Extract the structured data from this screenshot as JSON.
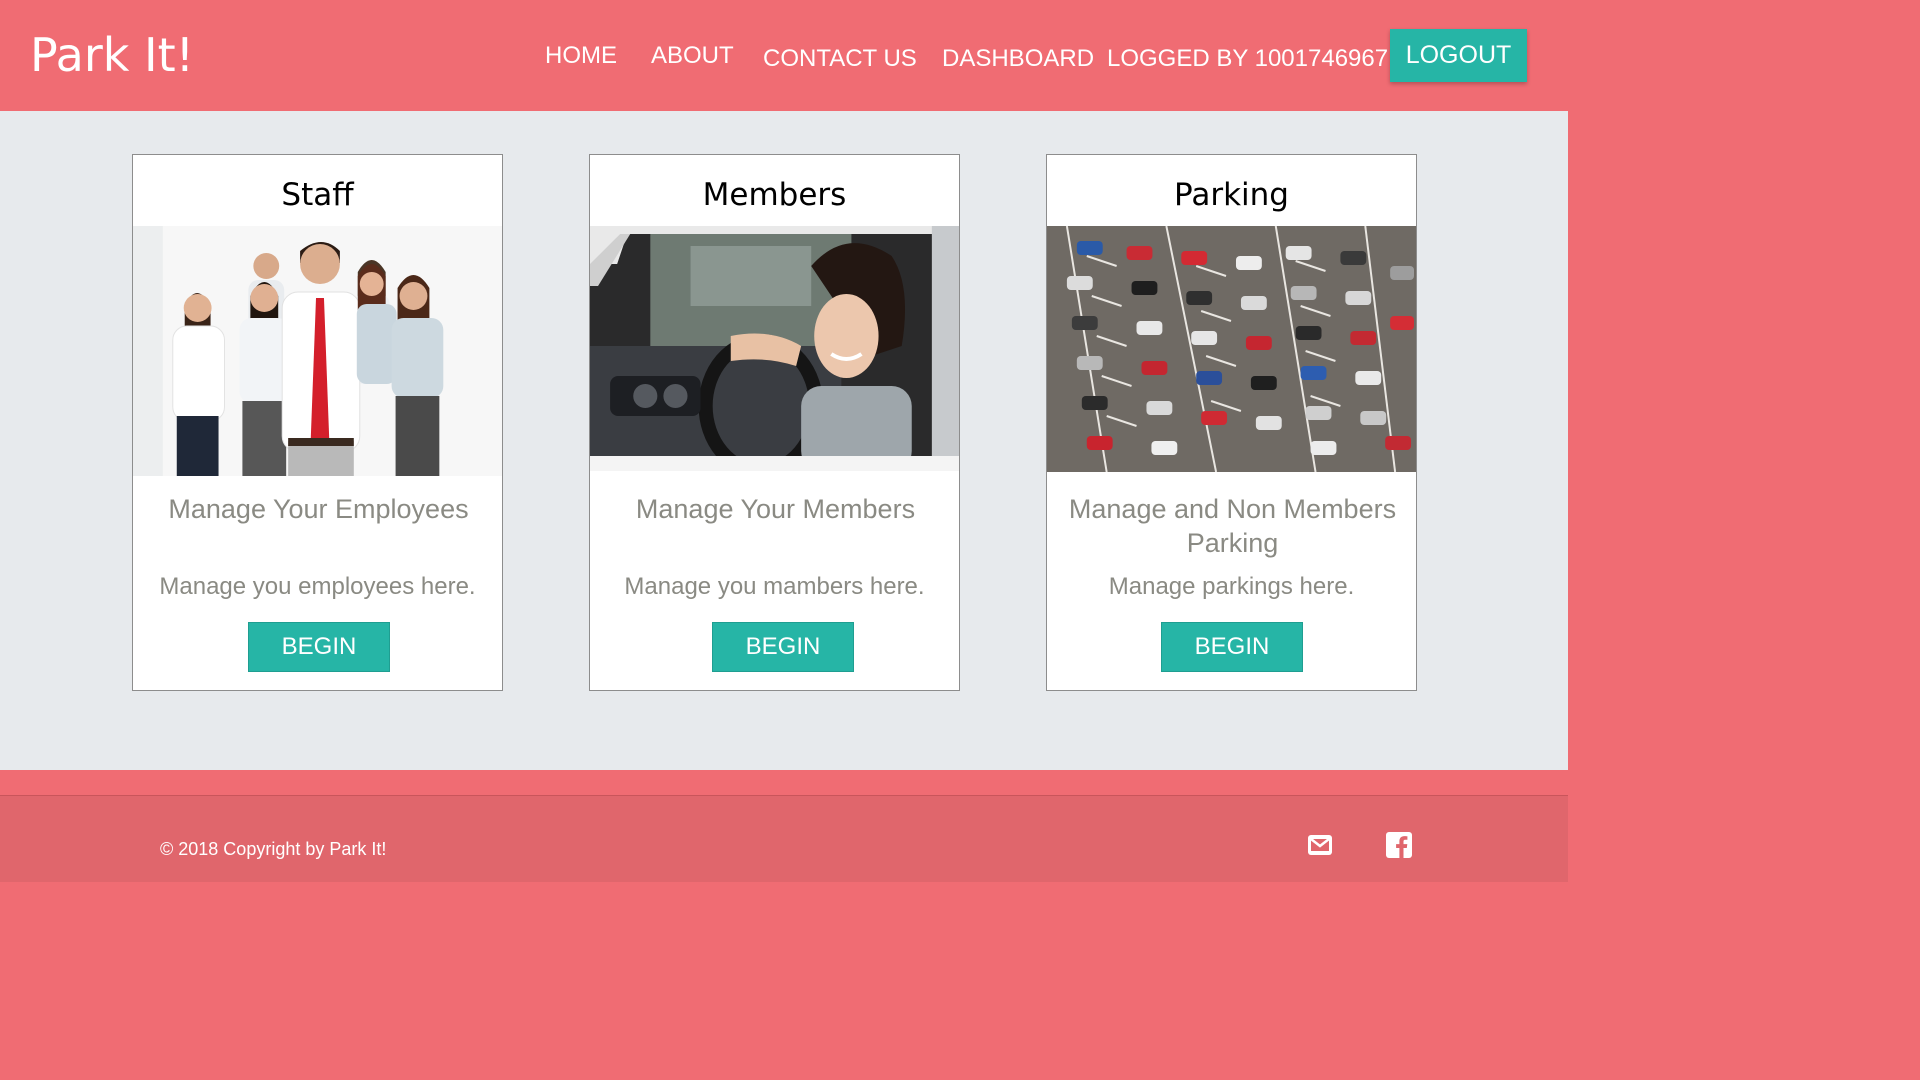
{
  "header": {
    "brand": "Park It!",
    "nav": {
      "home": "HOME",
      "about": "ABOUT",
      "contact": "CONTACT US",
      "dashboard": "DASHBOARD",
      "logged_by": "LOGGED BY 1001746967"
    },
    "logout_label": "LOGOUT"
  },
  "cards": [
    {
      "title": "Staff",
      "heading": "Manage Your Employees",
      "description": "Manage you employees here.",
      "button": "BEGIN",
      "image": "business-team-photo"
    },
    {
      "title": "Members",
      "heading": "Manage Your Members",
      "description": "Manage you mambers here.",
      "button": "BEGIN",
      "image": "woman-driving-car-photo"
    },
    {
      "title": "Parking",
      "heading": "Manage and Non Members Parking",
      "description": "Manage parkings here.",
      "button": "BEGIN",
      "image": "aerial-parking-lot-photo"
    }
  ],
  "footer": {
    "copyright": "© 2018 Copyright by Park It!",
    "icons": [
      "envelope-icon",
      "facebook-icon"
    ]
  },
  "colors": {
    "primary": "#f06c73",
    "accent": "#26b5a6",
    "background": "#e7eaed",
    "muted_text": "#8a8a83"
  }
}
